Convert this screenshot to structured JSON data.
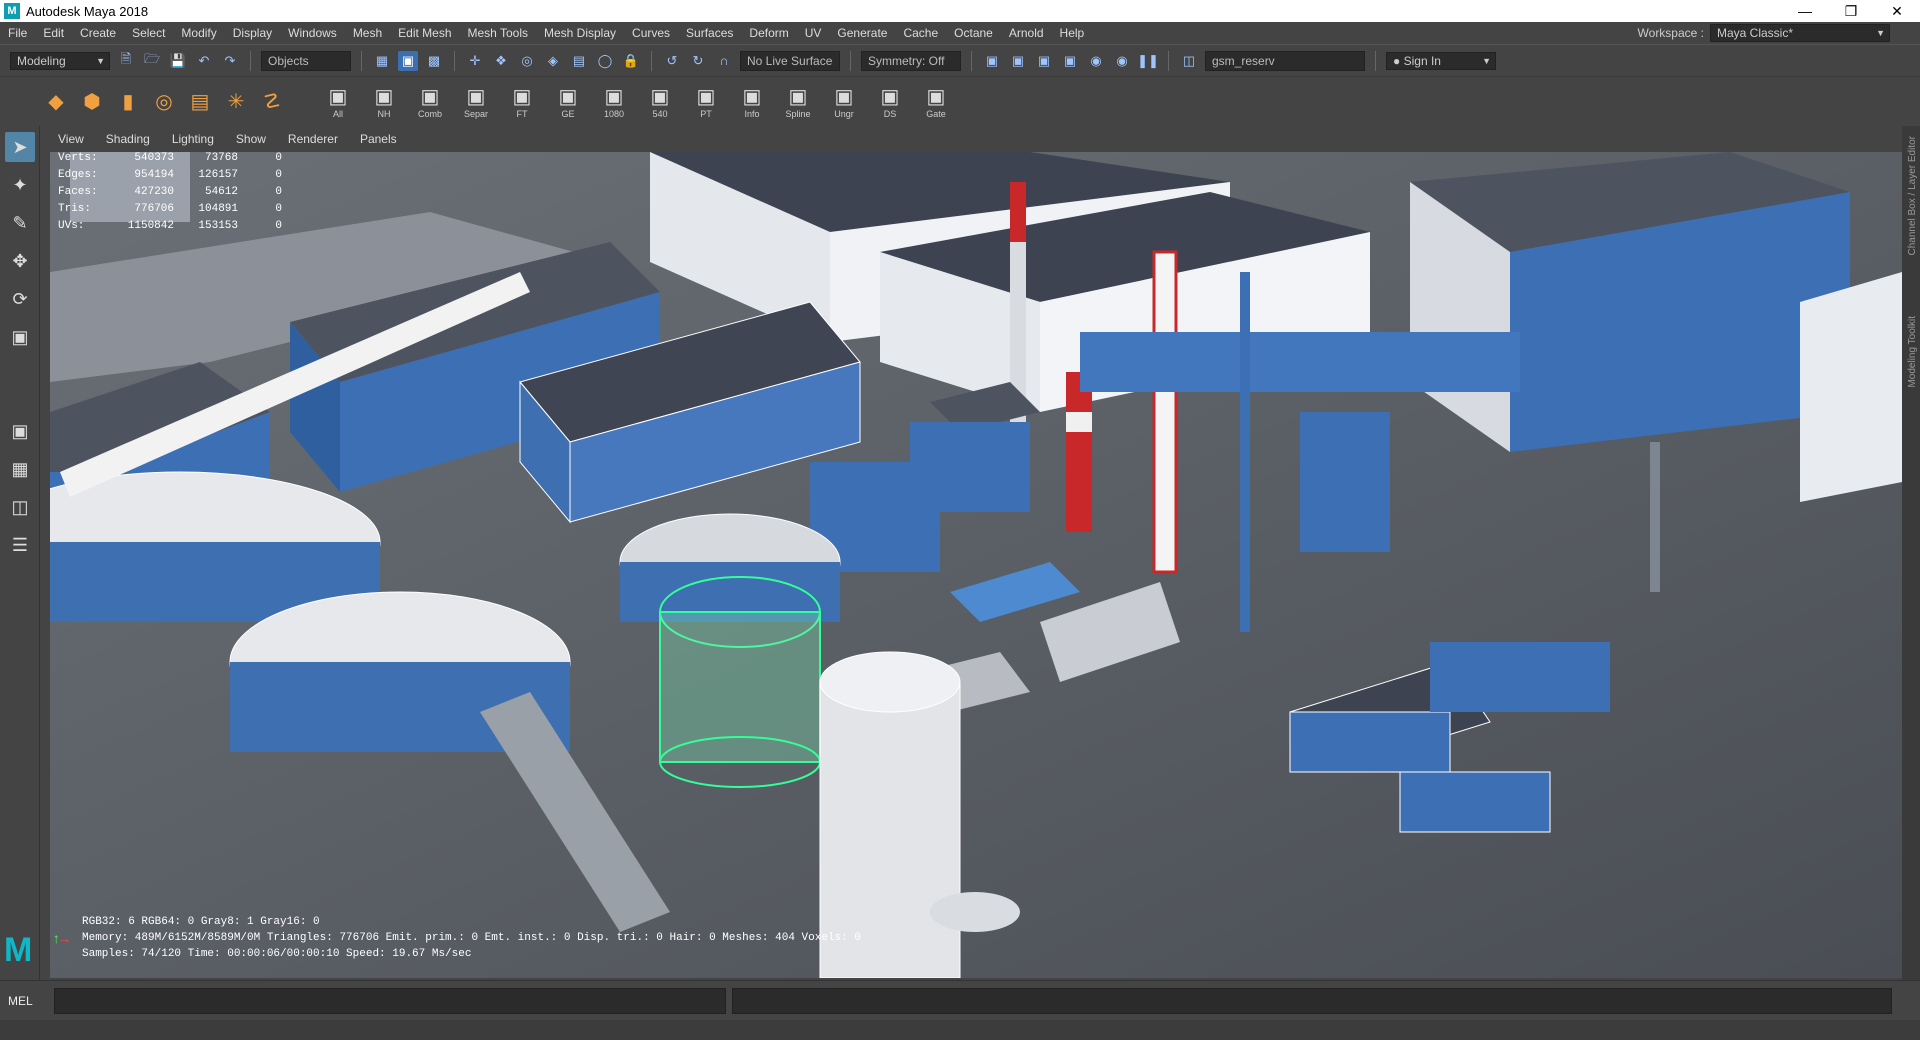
{
  "window": {
    "title": "Autodesk Maya 2018",
    "logo": "M"
  },
  "menu": [
    "File",
    "Edit",
    "Create",
    "Select",
    "Modify",
    "Display",
    "Windows",
    "Mesh",
    "Edit Mesh",
    "Mesh Tools",
    "Mesh Display",
    "Curves",
    "Surfaces",
    "Deform",
    "UV",
    "Generate",
    "Cache",
    "Octane",
    "Arnold",
    "Help"
  ],
  "workspace": {
    "label": "Workspace :",
    "value": "Maya Classic*"
  },
  "status": {
    "mode": "Modeling",
    "select_mode": "Objects",
    "live_surface": "No Live Surface",
    "symmetry": "Symmetry: Off",
    "name_field": "gsm_reserv",
    "sign_in": "Sign In"
  },
  "shelf": {
    "left_icons": [
      "cube-icon",
      "sphere-icon",
      "cylinder-icon",
      "torus-icon",
      "plane-icon",
      "star-icon",
      "link-icon"
    ],
    "labeled": [
      {
        "label": "All",
        "icon": "camera-icon"
      },
      {
        "label": "NH",
        "icon": "edit-icon"
      },
      {
        "label": "Comb",
        "icon": "combine-icon"
      },
      {
        "label": "Separ",
        "icon": "separate-icon"
      },
      {
        "label": "FT",
        "icon": "transform-icon"
      },
      {
        "label": "GE",
        "icon": "graph-icon"
      },
      {
        "label": "1080",
        "icon": "resolution-icon"
      },
      {
        "label": "540",
        "icon": "resolution-icon"
      },
      {
        "label": "PT",
        "icon": "pt-icon"
      },
      {
        "label": "Info",
        "icon": "info-icon"
      },
      {
        "label": "Spline",
        "icon": "spline-icon"
      },
      {
        "label": "Ungr",
        "icon": "ungroup-icon"
      },
      {
        "label": "DS",
        "icon": "ds-icon"
      },
      {
        "label": "Gate",
        "icon": "gate-icon"
      }
    ]
  },
  "panel_menu": [
    "View",
    "Shading",
    "Lighting",
    "Show",
    "Renderer",
    "Panels"
  ],
  "hud_stats": {
    "labels": [
      "Verts:",
      "Edges:",
      "Faces:",
      "Tris:",
      "UVs:"
    ],
    "col1": [
      "540373",
      "954194",
      "427230",
      "776706",
      "1150842"
    ],
    "col2": [
      "73768",
      "126157",
      "54612",
      "104891",
      "153153"
    ],
    "col3": [
      "0",
      "0",
      "0",
      "0",
      "0"
    ]
  },
  "hud_bottom": [
    "RGB32: 6 RGB64: 0 Gray8: 1 Gray16: 0",
    "Memory: 489M/6152M/8589M/0M Triangles: 776706 Emit. prim.: 0 Emt. inst.: 0 Disp. tri.: 0 Hair: 0 Meshes: 404 Voxels: 0",
    "Samples: 74/120 Time: 00:00:06/00:00:10 Speed: 19.67 Ms/sec"
  ],
  "side_panels": [
    "Channel Box / Layer Editor",
    "Modeling Toolkit"
  ],
  "cmd": {
    "label": "MEL"
  },
  "colors": {
    "accent": "#5285a6",
    "building_blue": "#3d6fb4",
    "selection_green": "#33ff99",
    "chimney_red": "#c8282a"
  }
}
